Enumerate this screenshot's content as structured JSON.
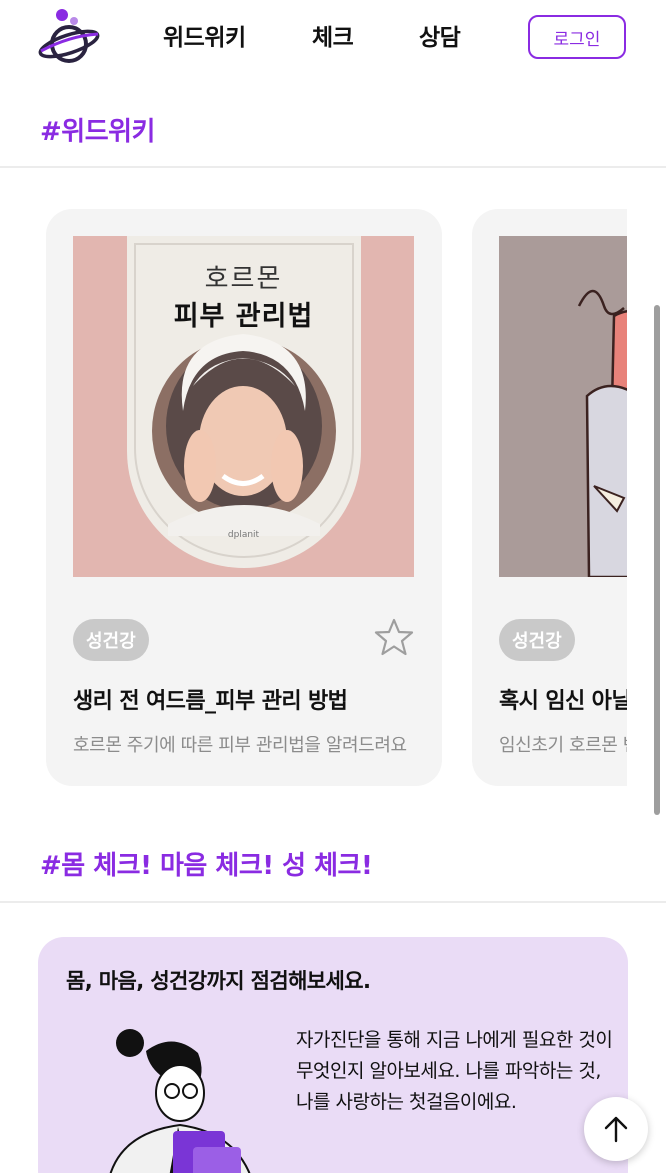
{
  "header": {
    "logo_icon": "planet-logo",
    "nav": {
      "wiki": "위드위키",
      "check": "체크",
      "consult": "상담"
    },
    "login_label": "로그인"
  },
  "sections": {
    "wiki_title": "#위드위키",
    "check_title": "#몸 체크! 마음 체크! 성 체크!"
  },
  "cards": [
    {
      "thumb_title_light": "호르몬",
      "thumb_title_bold": "피부 관리법",
      "thumb_brand": "dplanit",
      "badge": "성건강",
      "title": "생리 전 여드름_피부 관리 방법",
      "desc": "호르몬 주기에 따른 피부 관리법을 알려드려요",
      "favorite_icon": "star-outline-icon"
    },
    {
      "badge": "성건강",
      "title": "혹시 임신 아닐까?",
      "desc": "임신초기 호르몬 변화"
    }
  ],
  "check_card": {
    "heading": "몸, 마음, 성건강까지 점검해보세요.",
    "body": "자가진단을 통해 지금 나에게 필요한 것이 무엇인지 알아보세요. 나를 파악하는 것, 나를 사랑하는 첫걸음이에요."
  },
  "colors": {
    "accent": "#8a2be2",
    "card_bg": "#f4f4f4",
    "check_bg": "#eadcf6",
    "thumb_pink": "#e2b6b0"
  },
  "top_button_icon": "arrow-up-icon"
}
